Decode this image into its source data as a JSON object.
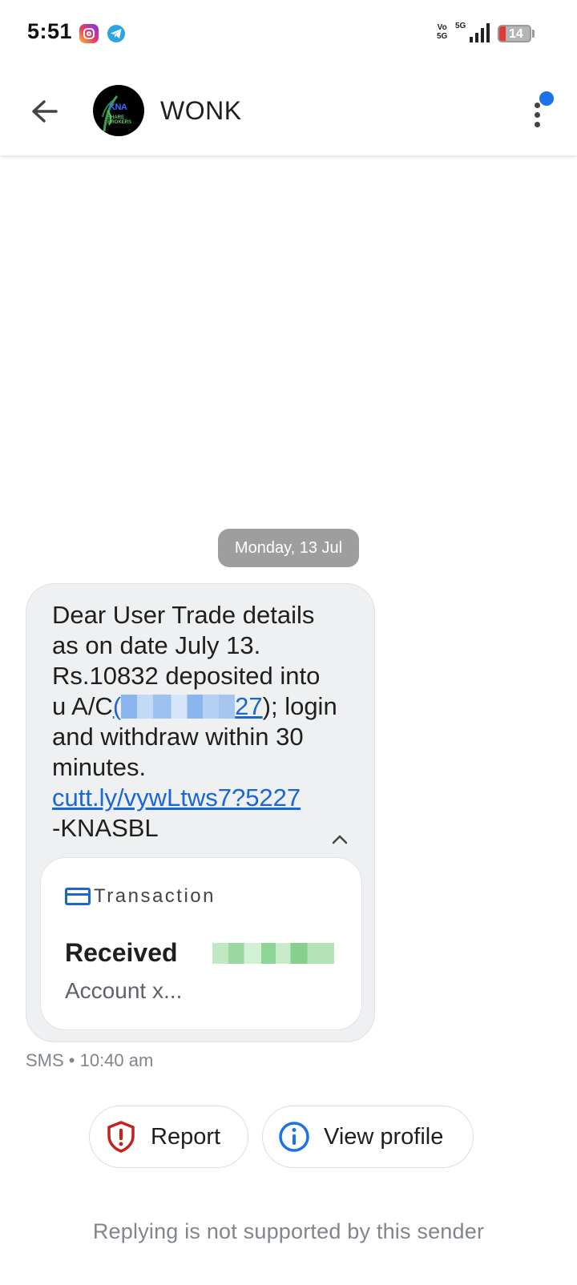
{
  "status_bar": {
    "time": "5:51",
    "volte_label": "Vo\n5G",
    "network_label": "5G",
    "battery_level": "14",
    "notification_icons": [
      "instagram-icon",
      "telegram-icon"
    ]
  },
  "app_bar": {
    "contact_name": "WONK",
    "avatar_text": "KNA",
    "avatar_subtext": "SHARE BROKERS"
  },
  "conversation": {
    "date_chip": "Monday, 13 Jul",
    "message": {
      "text_before_link": "Dear User Trade details as on date July 13. Rs.10832 deposited into u A/C",
      "account_link_prefix": "(",
      "account_link_visible": "27",
      "account_link_suffix": ");",
      "text_after_account": " login and withdraw within 30 minutes.",
      "url": "cutt.ly/vywLtws7?5227",
      "signature": "-KNASBL"
    },
    "transaction_card": {
      "label": "Transaction",
      "status": "Received",
      "account": "Account x..."
    },
    "meta": "SMS • 10:40 am"
  },
  "actions": {
    "report_label": "Report",
    "view_profile_label": "View profile"
  },
  "footer_note": "Replying is not supported by this sender",
  "colors": {
    "accent": "#1a73e8",
    "link": "#1a66d4",
    "report_red": "#c5221f",
    "bubble_bg": "#eef0f1",
    "date_chip_bg": "#9e9e9e"
  }
}
